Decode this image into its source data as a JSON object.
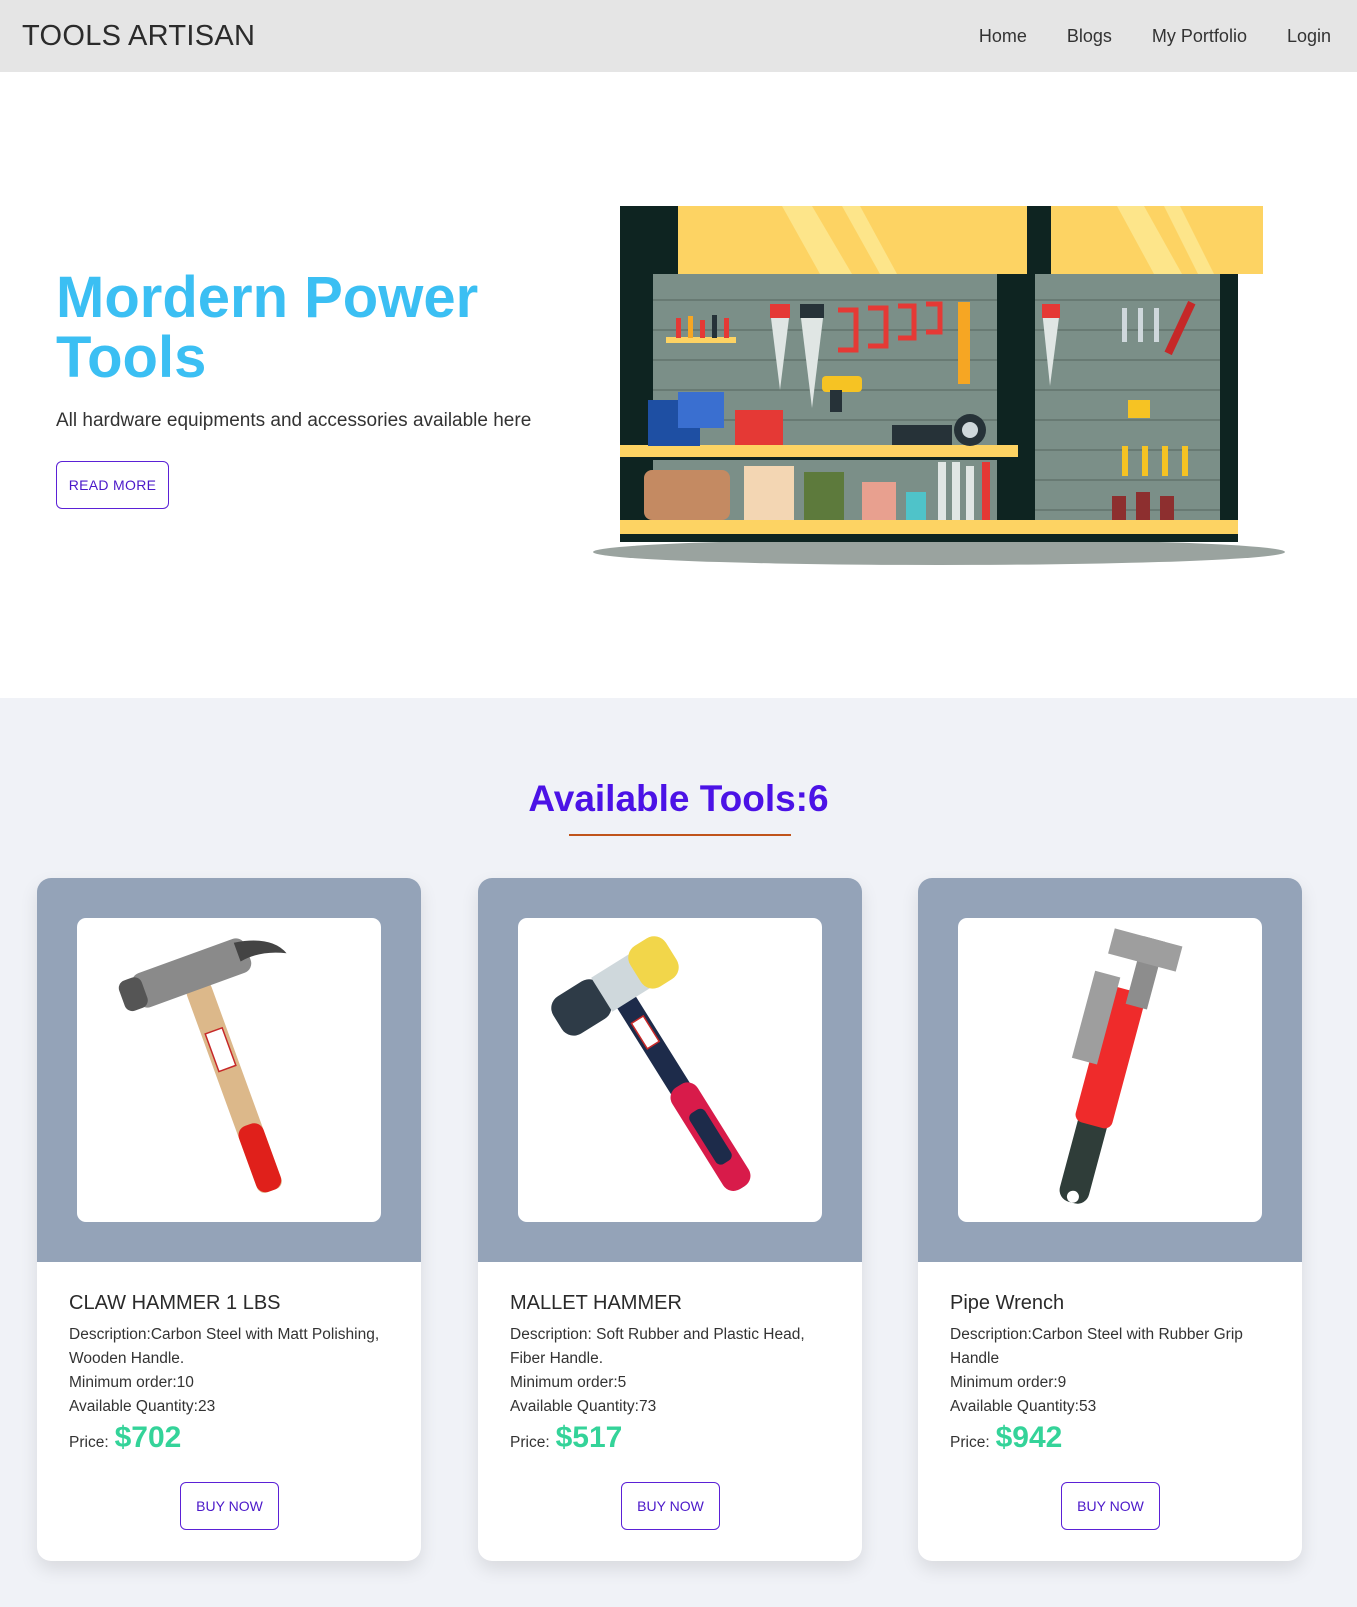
{
  "nav": {
    "brand": "TOOLS ARTISAN",
    "links": [
      "Home",
      "Blogs",
      "My Portfolio",
      "Login"
    ]
  },
  "hero": {
    "title": "Mordern Power Tools",
    "subtitle": "All hardware equipments and accessories available here",
    "cta_label": "READ MORE"
  },
  "tools": {
    "heading": "Available Tools:6",
    "items": [
      {
        "name": "CLAW HAMMER 1 LBS",
        "description": "Description:Carbon Steel with Matt Polishing, Wooden Handle.",
        "min_order": "Minimum order:10",
        "available": "Available Quantity:23",
        "price_label": "Price:",
        "price": "$702",
        "buy_label": "BUY NOW"
      },
      {
        "name": "MALLET HAMMER",
        "description": "Description: Soft Rubber and Plastic Head, Fiber Handle.",
        "min_order": "Minimum order:5",
        "available": "Available Quantity:73",
        "price_label": "Price:",
        "price": "$517",
        "buy_label": "BUY NOW"
      },
      {
        "name": "Pipe Wrench",
        "description": "Description:Carbon Steel with Rubber Grip Handle",
        "min_order": "Minimum order:9",
        "available": "Available Quantity:53",
        "price_label": "Price:",
        "price": "$942",
        "buy_label": "BUY NOW"
      }
    ]
  },
  "colors": {
    "hero_title": "#3bbff3",
    "heading": "#4b12e6",
    "price": "#34d399",
    "card_top": "#94a3b8",
    "section_bg": "#f0f2f7",
    "underline": "#c0541b"
  }
}
